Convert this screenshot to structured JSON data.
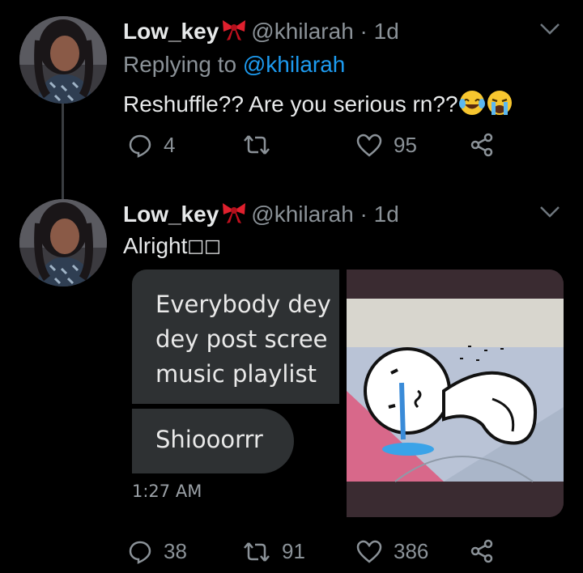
{
  "tweet1": {
    "display_name": "Low_key",
    "handle_time": "@khilarah · 1d",
    "replying_prefix": "Replying to",
    "replying_handle": "@khilarah",
    "text": "Reshuffle?? Are you serious rn??",
    "emojis": [
      "face-with-tears-of-joy-icon",
      "loudly-crying-face-icon"
    ],
    "replies": "4",
    "retweets": "",
    "likes": "95"
  },
  "tweet2": {
    "display_name": "Low_key",
    "handle_time": "@khilarah · 1d",
    "text": "Alright",
    "text_trailing_glyphs": "□□",
    "media": {
      "chat_message_1": "Everybody dey\ndey post scree\nmusic playlist",
      "chat_message_2": "Shiooorrr",
      "chat_time": "1:27 AM"
    },
    "replies": "38",
    "retweets": "91",
    "likes": "386"
  },
  "colors": {
    "background": "#000000",
    "text": "#e7e9ea",
    "secondary": "#8b9298",
    "link": "#1d9bf0",
    "bubble": "#2e3133"
  }
}
